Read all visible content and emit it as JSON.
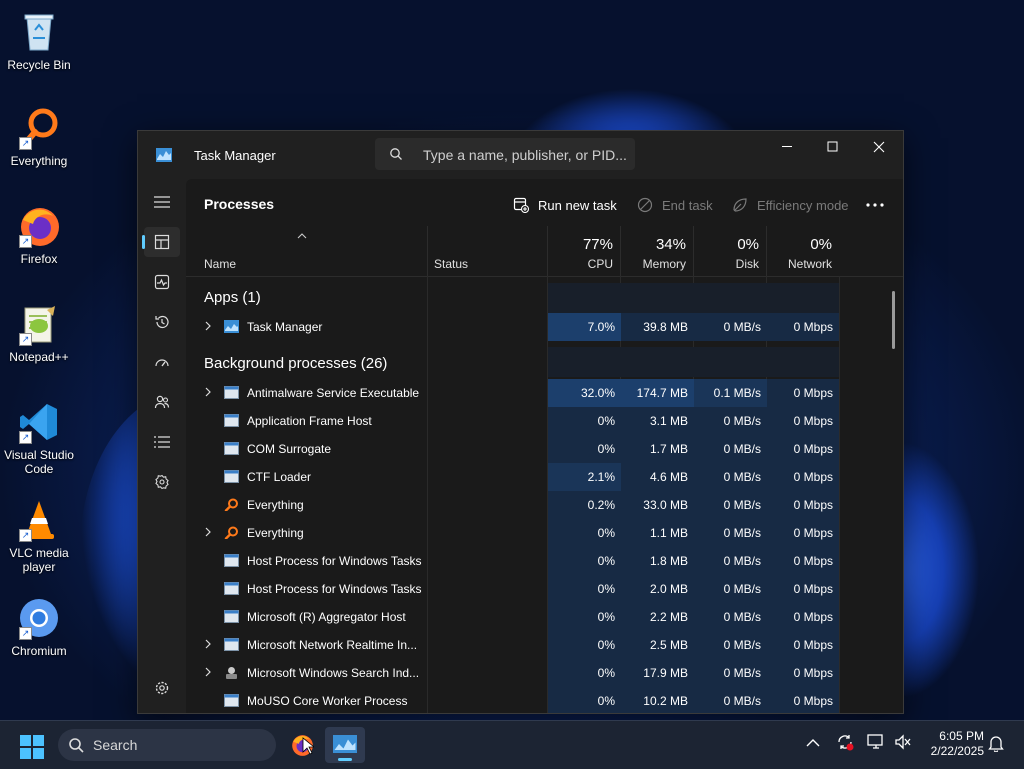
{
  "desktop": {
    "icons": [
      {
        "label": "Recycle Bin"
      },
      {
        "label": "Everything"
      },
      {
        "label": "Firefox"
      },
      {
        "label": "Notepad++"
      },
      {
        "label": "Visual Studio Code"
      },
      {
        "label": "VLC media player"
      },
      {
        "label": "Chromium"
      }
    ]
  },
  "window": {
    "title": "Task Manager",
    "search_placeholder": "Type a name, publisher, or PID..."
  },
  "nav": {
    "items": [
      "hamburger-icon",
      "processes-icon",
      "performance-icon",
      "app-history-icon",
      "startup-apps-icon",
      "users-icon",
      "details-icon",
      "services-icon",
      "settings-icon"
    ],
    "active": "processes-icon"
  },
  "toolbar": {
    "heading": "Processes",
    "run_new_task": "Run new task",
    "end_task": "End task",
    "efficiency_mode": "Efficiency mode"
  },
  "columns": {
    "name": "Name",
    "status": "Status",
    "cpu": {
      "pct": "77%",
      "label": "CPU"
    },
    "memory": {
      "pct": "34%",
      "label": "Memory"
    },
    "disk": {
      "pct": "0%",
      "label": "Disk"
    },
    "network": {
      "pct": "0%",
      "label": "Network"
    }
  },
  "groups": {
    "apps": "Apps (1)",
    "background": "Background processes (26)"
  },
  "apps": [
    {
      "name": "Task Manager",
      "cpu": "7.0%",
      "memory": "39.8 MB",
      "disk": "0 MB/s",
      "network": "0 Mbps"
    }
  ],
  "background": [
    {
      "name": "Antimalware Service Executable",
      "cpu": "32.0%",
      "memory": "174.7 MB",
      "disk": "0.1 MB/s",
      "network": "0 Mbps"
    },
    {
      "name": "Application Frame Host",
      "cpu": "0%",
      "memory": "3.1 MB",
      "disk": "0 MB/s",
      "network": "0 Mbps"
    },
    {
      "name": "COM Surrogate",
      "cpu": "0%",
      "memory": "1.7 MB",
      "disk": "0 MB/s",
      "network": "0 Mbps"
    },
    {
      "name": "CTF Loader",
      "cpu": "2.1%",
      "memory": "4.6 MB",
      "disk": "0 MB/s",
      "network": "0 Mbps"
    },
    {
      "name": "Everything",
      "cpu": "0.2%",
      "memory": "33.0 MB",
      "disk": "0 MB/s",
      "network": "0 Mbps"
    },
    {
      "name": "Everything",
      "cpu": "0%",
      "memory": "1.1 MB",
      "disk": "0 MB/s",
      "network": "0 Mbps"
    },
    {
      "name": "Host Process for Windows Tasks",
      "cpu": "0%",
      "memory": "1.8 MB",
      "disk": "0 MB/s",
      "network": "0 Mbps"
    },
    {
      "name": "Host Process for Windows Tasks",
      "cpu": "0%",
      "memory": "2.0 MB",
      "disk": "0 MB/s",
      "network": "0 Mbps"
    },
    {
      "name": "Microsoft (R) Aggregator Host",
      "cpu": "0%",
      "memory": "2.2 MB",
      "disk": "0 MB/s",
      "network": "0 Mbps"
    },
    {
      "name": "Microsoft Network Realtime In...",
      "cpu": "0%",
      "memory": "2.5 MB",
      "disk": "0 MB/s",
      "network": "0 Mbps"
    },
    {
      "name": "Microsoft Windows Search Ind...",
      "cpu": "0%",
      "memory": "17.9 MB",
      "disk": "0 MB/s",
      "network": "0 Mbps"
    },
    {
      "name": "MoUSO Core Worker Process",
      "cpu": "0%",
      "memory": "10.2 MB",
      "disk": "0 MB/s",
      "network": "0 Mbps"
    }
  ],
  "taskbar": {
    "search_label": "Search",
    "time": "6:05 PM",
    "date": "2/22/2025"
  },
  "colors": {
    "accent": "#60cdff",
    "heat_low": "#172a44",
    "heat_mid": "#1a3558",
    "heat_high": "#1c3f6c"
  }
}
